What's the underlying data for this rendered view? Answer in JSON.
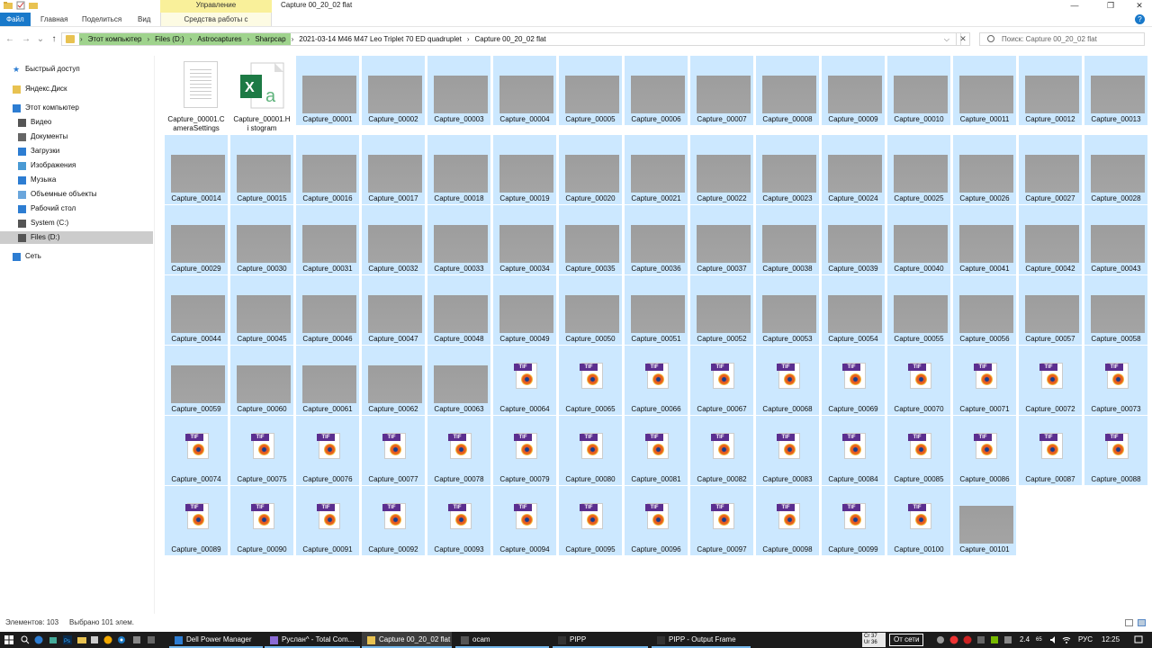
{
  "window": {
    "title": "Capture 00_20_02 flat",
    "contextual_header": "Управление",
    "minimize": "—",
    "maximize": "❐",
    "close": "✕"
  },
  "ribbon": {
    "tabs": [
      "Файл",
      "Главная",
      "Поделиться",
      "Вид"
    ],
    "contextual_tab": "Средства работы с рисунками",
    "help": "?"
  },
  "address": {
    "crumbs": [
      "Этот компьютер",
      "Files (D:)",
      "Astrocaptures",
      "Sharpcap",
      "2021-03-14 M46 M47 Leo Triplet 70 ED quadruplet",
      "Capture 00_20_02 flat"
    ],
    "separator": "›",
    "dropdown": "⌵",
    "clear": "✕"
  },
  "search": {
    "placeholder": "Поиск: Capture 00_20_02 flat"
  },
  "nav": {
    "back": "←",
    "forward": "→",
    "recent": "⌄",
    "up": "↑",
    "items": [
      {
        "label": "Быстрый доступ",
        "icon": "star-icon"
      },
      {
        "label": "Яндекс.Диск",
        "icon": "yandex-disk-icon"
      },
      {
        "label": "Этот компьютер",
        "icon": "computer-icon"
      },
      {
        "label": "Видео",
        "icon": "video-icon"
      },
      {
        "label": "Документы",
        "icon": "documents-icon"
      },
      {
        "label": "Загрузки",
        "icon": "downloads-icon"
      },
      {
        "label": "Изображения",
        "icon": "pictures-icon"
      },
      {
        "label": "Музыка",
        "icon": "music-icon"
      },
      {
        "label": "Объемные объекты",
        "icon": "3d-objects-icon"
      },
      {
        "label": "Рабочий стол",
        "icon": "desktop-icon"
      },
      {
        "label": "System (C:)",
        "icon": "drive-c-icon"
      },
      {
        "label": "Files (D:)",
        "icon": "drive-d-icon"
      },
      {
        "label": "Сеть",
        "icon": "network-icon"
      }
    ]
  },
  "files": {
    "special": [
      {
        "name": "Capture_00001.CameraSettings",
        "type": "text-document",
        "display": "Capture_00001.C ameraSettings"
      },
      {
        "name": "Capture_00001.Histogram",
        "type": "excel-document",
        "display": "Capture_00001.Hi stogram"
      }
    ],
    "tif_label": "TIF",
    "prefix": "Capture_",
    "count": 101,
    "tif_from": 64,
    "tif_to": 100
  },
  "status": {
    "items": "Элементов: 103",
    "selected": "Выбрано 101 элем."
  },
  "taskbar": {
    "apps": [
      {
        "label": "Dell Power Manager"
      },
      {
        "label": "Руслан^ - Total Com..."
      },
      {
        "label": "Capture 00_20_02 flat"
      },
      {
        "label": "ocam"
      },
      {
        "label": "PIPP"
      },
      {
        "label": "PIPP - Output Frame"
      }
    ],
    "cpu": "Cr 37\nUr 36",
    "network": "От сети",
    "speed": "2.4",
    "speed2": "65",
    "lang": "РУС",
    "time": "12:25"
  },
  "colors": {
    "selection": "#cce8ff",
    "accent": "#1979ca",
    "crumb_highlight": "#9fd38d",
    "contextual": "#f9f09a"
  }
}
